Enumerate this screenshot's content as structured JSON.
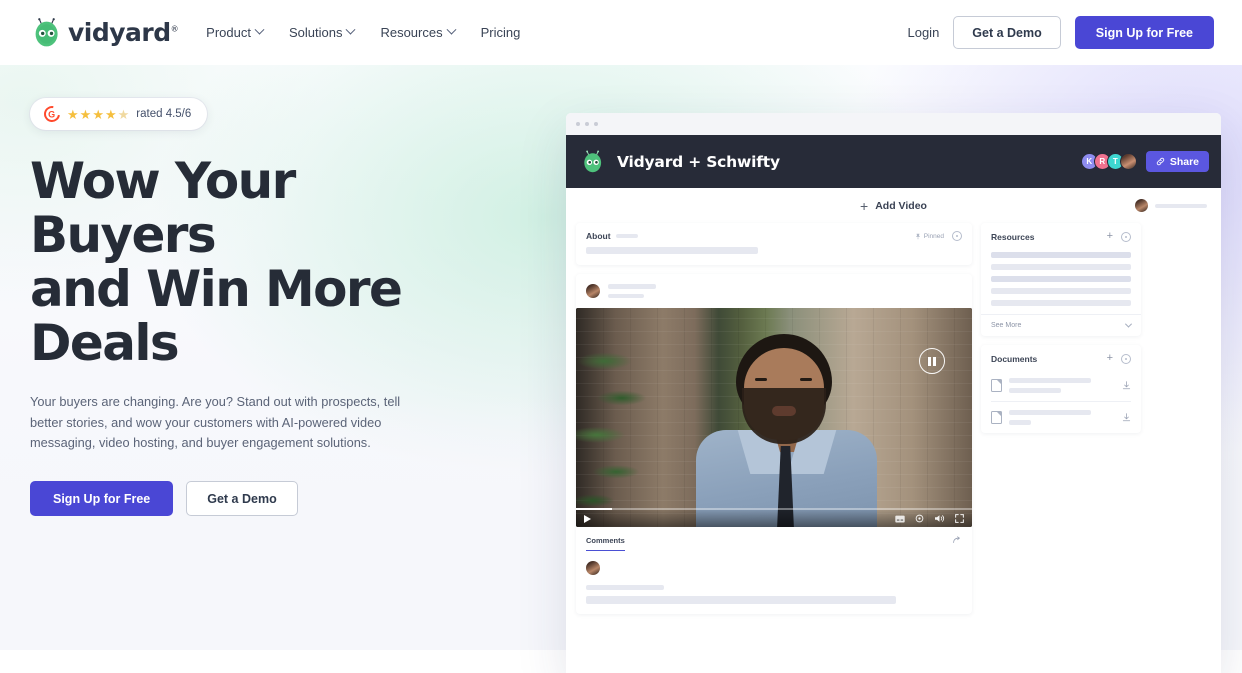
{
  "brand": {
    "name": "vidyard",
    "registered": "®",
    "accent": "#4a47d5",
    "green": "#4ec27c",
    "dark": "#272b38"
  },
  "nav": {
    "items": [
      {
        "label": "Product",
        "has_caret": true
      },
      {
        "label": "Solutions",
        "has_caret": true
      },
      {
        "label": "Resources",
        "has_caret": true
      },
      {
        "label": "Pricing",
        "has_caret": false
      }
    ],
    "login_label": "Login",
    "demo_label": "Get a Demo",
    "signup_label": "Sign Up for Free"
  },
  "hero": {
    "rating": {
      "source": "G2",
      "source_glyph": "G",
      "stars": [
        "full",
        "full",
        "full",
        "full",
        "half"
      ],
      "text": "rated 4.5/6"
    },
    "headline_line1": "Wow Your Buyers",
    "headline_line2": "and Win More Deals",
    "subcopy": "Your buyers are changing. Are you? Stand out with prospects, tell better stories, and wow your customers with AI-powered video messaging, video hosting, and buyer engagement solutions.",
    "cta_primary": "Sign Up for Free",
    "cta_secondary": "Get a Demo"
  },
  "mockup": {
    "header": {
      "title": "Vidyard + Schwifty",
      "avatars": [
        {
          "initial": "K",
          "color": "#8e8cf0"
        },
        {
          "initial": "R",
          "color": "#f0728f"
        },
        {
          "initial": "T",
          "color": "#3ed6d0"
        },
        {
          "initial": "",
          "color": "photo"
        }
      ],
      "share_label": "Share"
    },
    "toolbar": {
      "add_video_label": "Add Video"
    },
    "about_card": {
      "title": "About",
      "pinned_label": "Pinned"
    },
    "comments_card": {
      "tab_label": "Comments"
    },
    "resources_card": {
      "title": "Resources",
      "see_more_label": "See More",
      "line_count": 5
    },
    "documents_card": {
      "title": "Documents",
      "rows": 2
    },
    "video": {
      "progress_percent": 9,
      "state": "paused"
    }
  }
}
